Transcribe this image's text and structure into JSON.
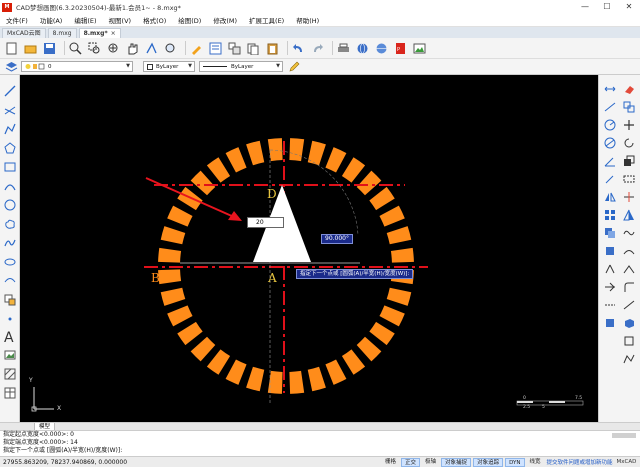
{
  "window": {
    "title": "CAD梦想画图(6.3.20230504)-最新1.会员1~ - 8.mxg*",
    "logo_text": "M",
    "controls": [
      "—",
      "☐",
      "✕"
    ]
  },
  "menu": [
    "文件(F)",
    "功能(A)",
    "编辑(E)",
    "视图(V)",
    "格式(O)",
    "绘图(D)",
    "修改(M)",
    "扩展工具(E)",
    "帮助(H)"
  ],
  "doc_tabs": [
    {
      "label": "MxCAD云图",
      "active": false
    },
    {
      "label": "8.mxg",
      "active": false
    },
    {
      "label": "8.mxg*",
      "active": true
    }
  ],
  "props": {
    "layer_value": "0",
    "color_value": "ByLayer",
    "linetype_value": "ByLayer"
  },
  "canvas": {
    "labels": {
      "a": "A",
      "b": "B",
      "d": "D"
    },
    "dynamic_input": "20",
    "angle_tip": "90.000°",
    "prompt_tip": "指定下一个点或 [圆弧(A)/半宽(H)/宽度(W)]:",
    "ucs_x": "X",
    "ucs_y": "Y",
    "scale_labels": {
      "s0": "0",
      "s1": "5",
      "s2": "7.5",
      "s3": "2.5"
    },
    "colors": {
      "ring": "#ff8c1a",
      "axis": "#e0101a",
      "triangle": "#ffffff"
    }
  },
  "model_tab": "模型",
  "command_lines": [
    "指定起点宽度<0.000>: 0",
    "指定端点宽度<0.000>: 14",
    "指定下一个点或 [圆弧(A)/半宽(H)/宽度(W)]:"
  ],
  "status": {
    "coords": "27955.863209, 78237.940869, 0.000000",
    "buttons": [
      {
        "label": "栅格",
        "on": false
      },
      {
        "label": "正交",
        "on": true
      },
      {
        "label": "极轴",
        "on": false
      },
      {
        "label": "对象捕捉",
        "on": true
      },
      {
        "label": "对象追踪",
        "on": true
      },
      {
        "label": "DYN",
        "on": true
      },
      {
        "label": "线宽",
        "on": false
      }
    ],
    "link": "提交软件问题或增加新功能",
    "brand": "MxCAD"
  }
}
